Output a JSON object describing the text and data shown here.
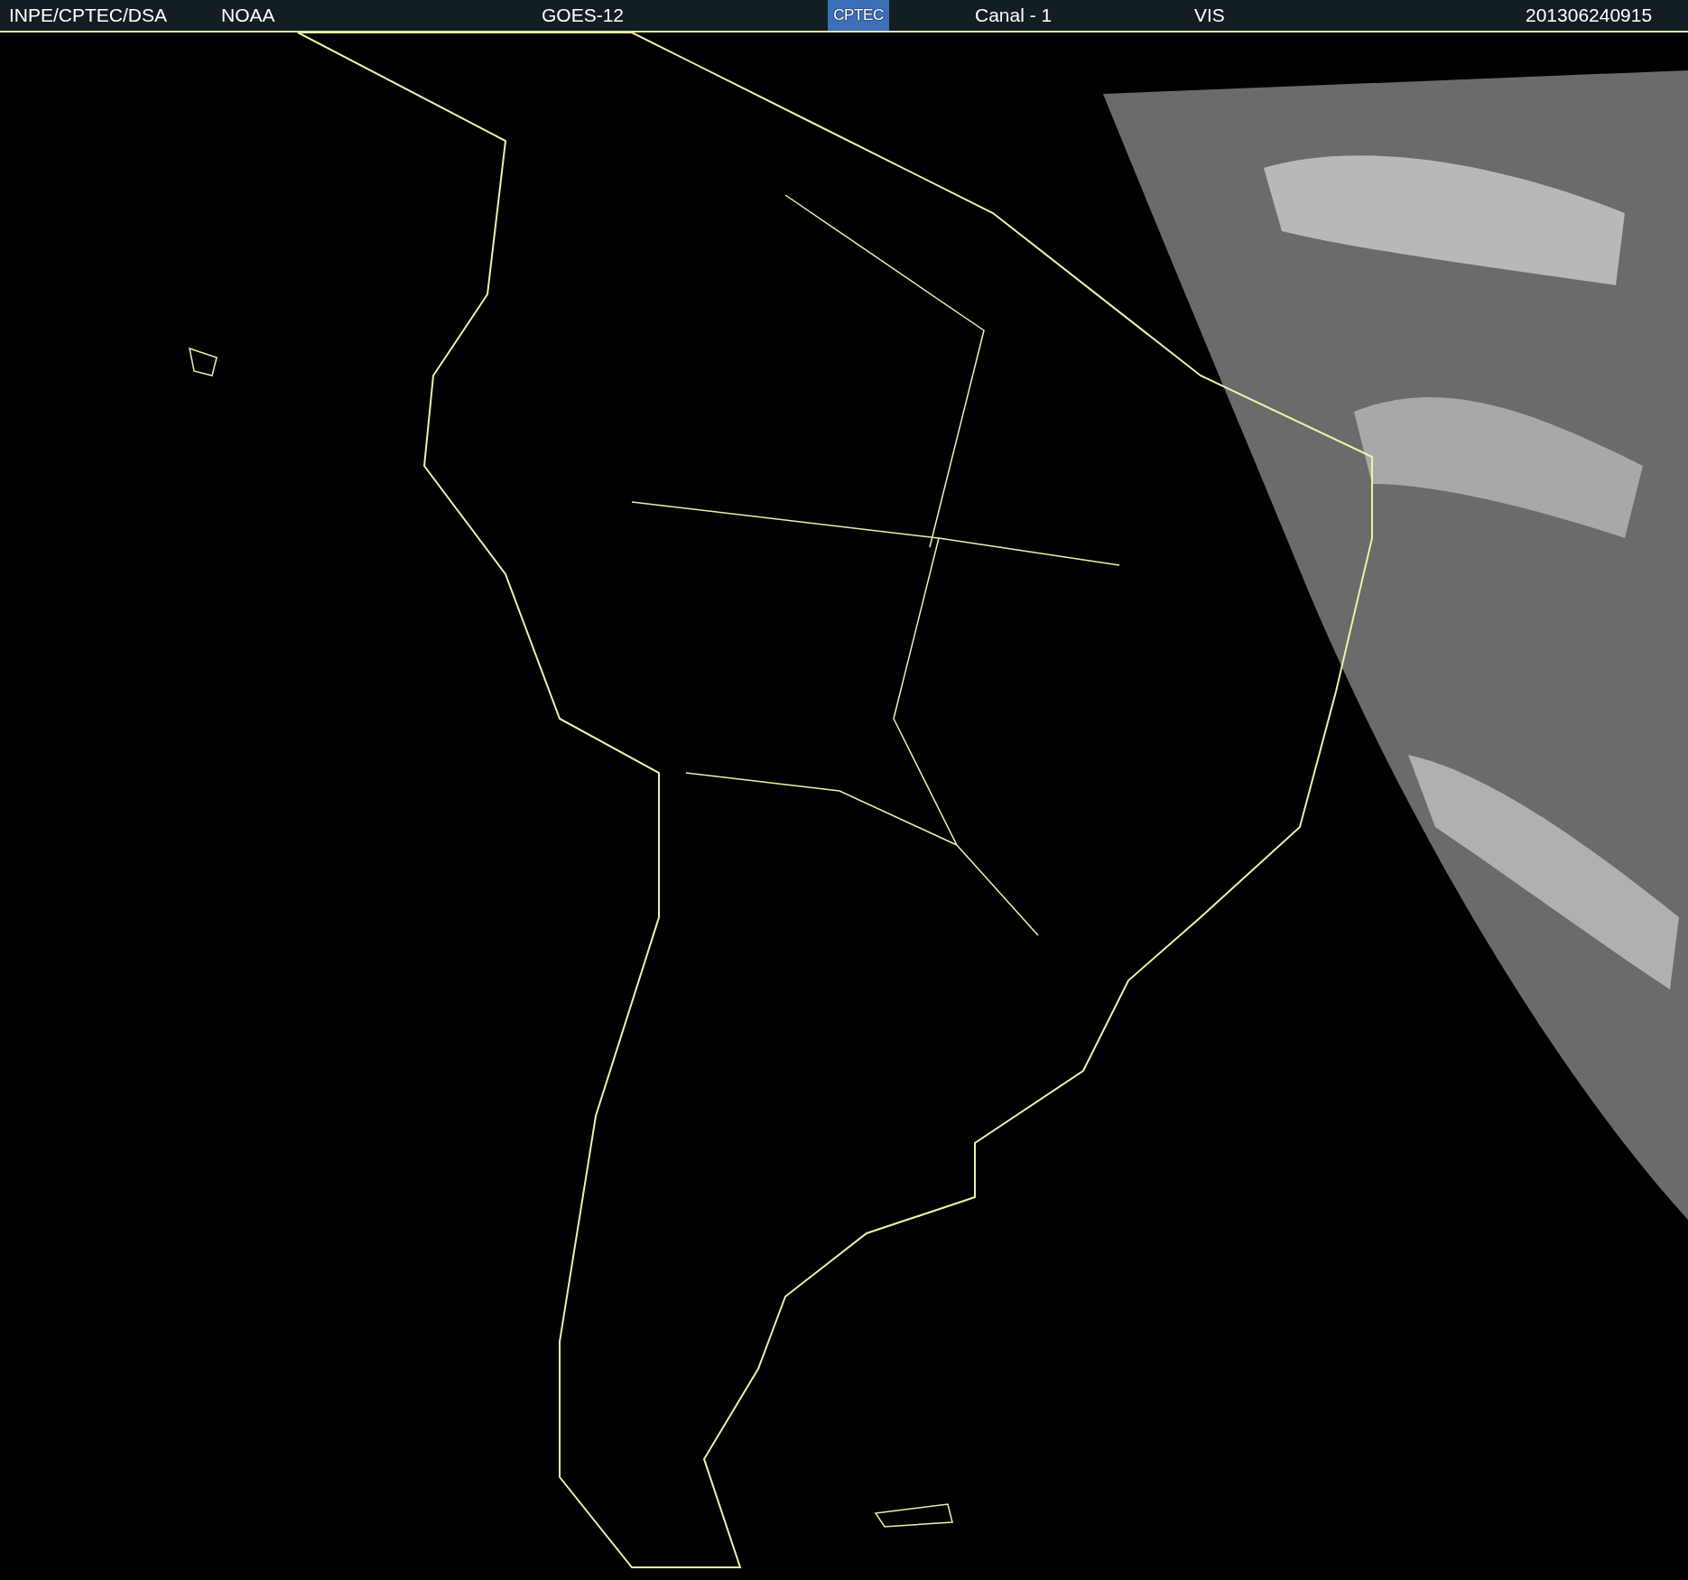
{
  "header": {
    "items": [
      {
        "kind": "text",
        "text": "INPE/CPTEC/DSA"
      },
      {
        "kind": "text",
        "text": "NOAA"
      },
      {
        "kind": "text",
        "text": "GOES-12"
      },
      {
        "kind": "logo",
        "text": "CPTEC"
      },
      {
        "kind": "text",
        "text": "Canal - 1"
      },
      {
        "kind": "text",
        "text": "VIS"
      },
      {
        "kind": "text",
        "text": "201306240915"
      }
    ]
  }
}
